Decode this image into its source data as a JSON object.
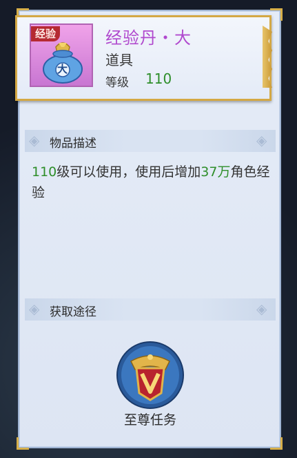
{
  "item": {
    "icon_tag": "经验",
    "icon_glyph": "大",
    "name": "经验丹・大",
    "type": "道具",
    "level_label": "等级",
    "level_value": "110"
  },
  "sections": {
    "description_title": "物品描述",
    "source_title": "获取途径"
  },
  "description": {
    "level": "110",
    "part1": "级可以使用，使用后增加",
    "amount": "37万",
    "part2": "角色经验"
  },
  "source": {
    "label": "至尊任务",
    "icon": "vip-v-emblem-icon"
  },
  "colors": {
    "name": "#b049ce",
    "highlight": "#2e8e2a",
    "frame_gold": "#d4a844"
  }
}
